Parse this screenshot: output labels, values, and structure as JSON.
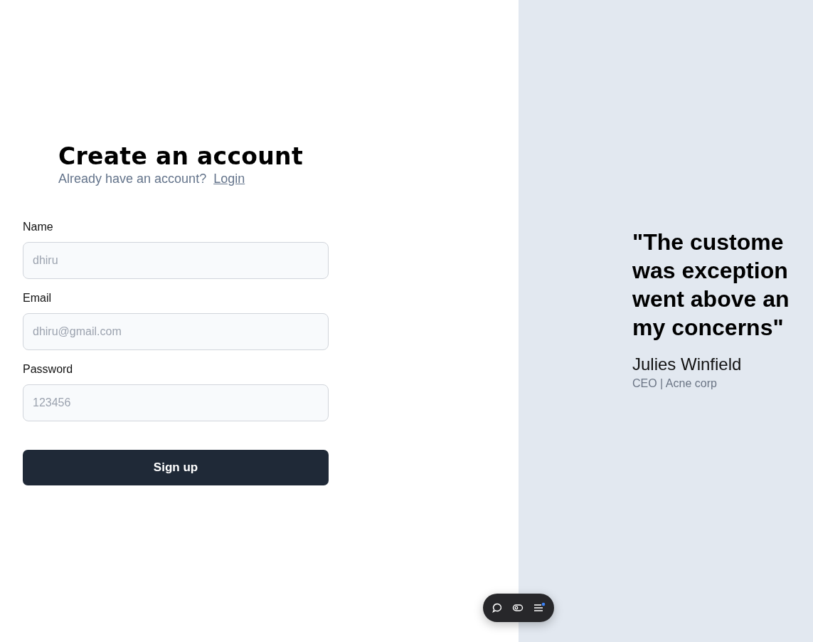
{
  "form": {
    "title": "Create an account",
    "prompt": "Already have an account?",
    "login_link": "Login",
    "fields": [
      {
        "label": "Name",
        "placeholder": "dhiru"
      },
      {
        "label": "Email",
        "placeholder": "dhiru@gmail.com"
      },
      {
        "label": "Password",
        "placeholder": "123456"
      }
    ],
    "submit": "Sign up"
  },
  "testimonial": {
    "quote_lines": [
      "\"The custome",
      "was exception",
      "went above an",
      "my concerns\""
    ],
    "author": "Julies Winfield",
    "role": "CEO | Acne corp"
  },
  "toolbar": {
    "notification": true
  }
}
